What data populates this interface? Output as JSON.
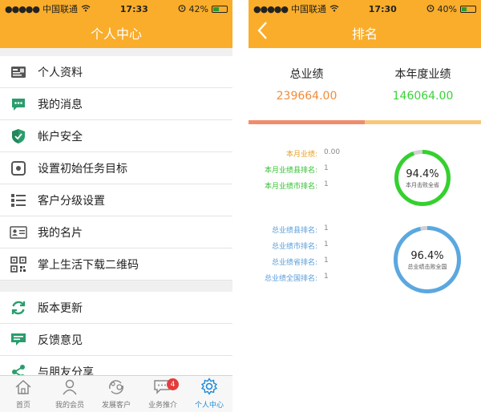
{
  "left": {
    "status": {
      "carrier": "中国联通",
      "time": "17:33",
      "battery": "42%",
      "battery_level": 0.42
    },
    "title": "个人中心",
    "menu_group1": [
      {
        "label": "个人资料",
        "icon": "profile-card-icon"
      },
      {
        "label": "我的消息",
        "icon": "message-icon"
      },
      {
        "label": "帐户安全",
        "icon": "shield-icon"
      },
      {
        "label": "设置初始任务目标",
        "icon": "target-icon"
      },
      {
        "label": "客户分级设置",
        "icon": "list-icon"
      },
      {
        "label": "我的名片",
        "icon": "business-card-icon"
      },
      {
        "label": "掌上生活下载二维码",
        "icon": "qrcode-icon"
      }
    ],
    "menu_group2": [
      {
        "label": "版本更新",
        "icon": "refresh-icon"
      },
      {
        "label": "反馈意见",
        "icon": "feedback-icon"
      },
      {
        "label": "与朋友分享",
        "icon": "share-icon"
      }
    ],
    "tabs": [
      {
        "label": "首页",
        "icon": "home-icon"
      },
      {
        "label": "我的会员",
        "icon": "member-icon"
      },
      {
        "label": "发展客户",
        "icon": "develop-customer-icon"
      },
      {
        "label": "业务推介",
        "icon": "chat-icon",
        "badge": "4"
      },
      {
        "label": "个人中心",
        "icon": "gear-icon",
        "active": true
      }
    ],
    "colors": {
      "accent": "#f9ad2a",
      "tab_active": "#1d8ad8"
    }
  },
  "right": {
    "status": {
      "carrier": "中国联通",
      "time": "17:30",
      "battery": "40%",
      "battery_level": 0.4
    },
    "title": "排名",
    "summary": [
      {
        "label": "总业绩",
        "value": "239664.00",
        "color": "#f08c3a"
      },
      {
        "label": "本年度业绩",
        "value": "146064.00",
        "color": "#3bd23b"
      }
    ],
    "month_rows": [
      {
        "label": "本月业绩:",
        "value": "0.00"
      },
      {
        "label": "本月业绩县排名:",
        "value": "1"
      },
      {
        "label": "本月业绩市排名:",
        "value": "1"
      }
    ],
    "month_gauge": {
      "percent": "94.4%",
      "caption": "本月击败全省",
      "fraction": 0.944,
      "color": "#34d12e"
    },
    "total_rows": [
      {
        "label": "总业绩县排名:",
        "value": "1"
      },
      {
        "label": "总业绩市排名:",
        "value": "1"
      },
      {
        "label": "总业绩省排名:",
        "value": "1"
      },
      {
        "label": "总业绩全国排名:",
        "value": "1"
      }
    ],
    "total_gauge": {
      "percent": "96.4%",
      "caption": "总业绩击败全国",
      "fraction": 0.964,
      "color": "#5aa8e0"
    },
    "colors": {
      "month_label": "#e8a020",
      "month_label_alt": "#34c034",
      "total_label": "#5a9ed8",
      "track": "#d0d0d0"
    }
  }
}
